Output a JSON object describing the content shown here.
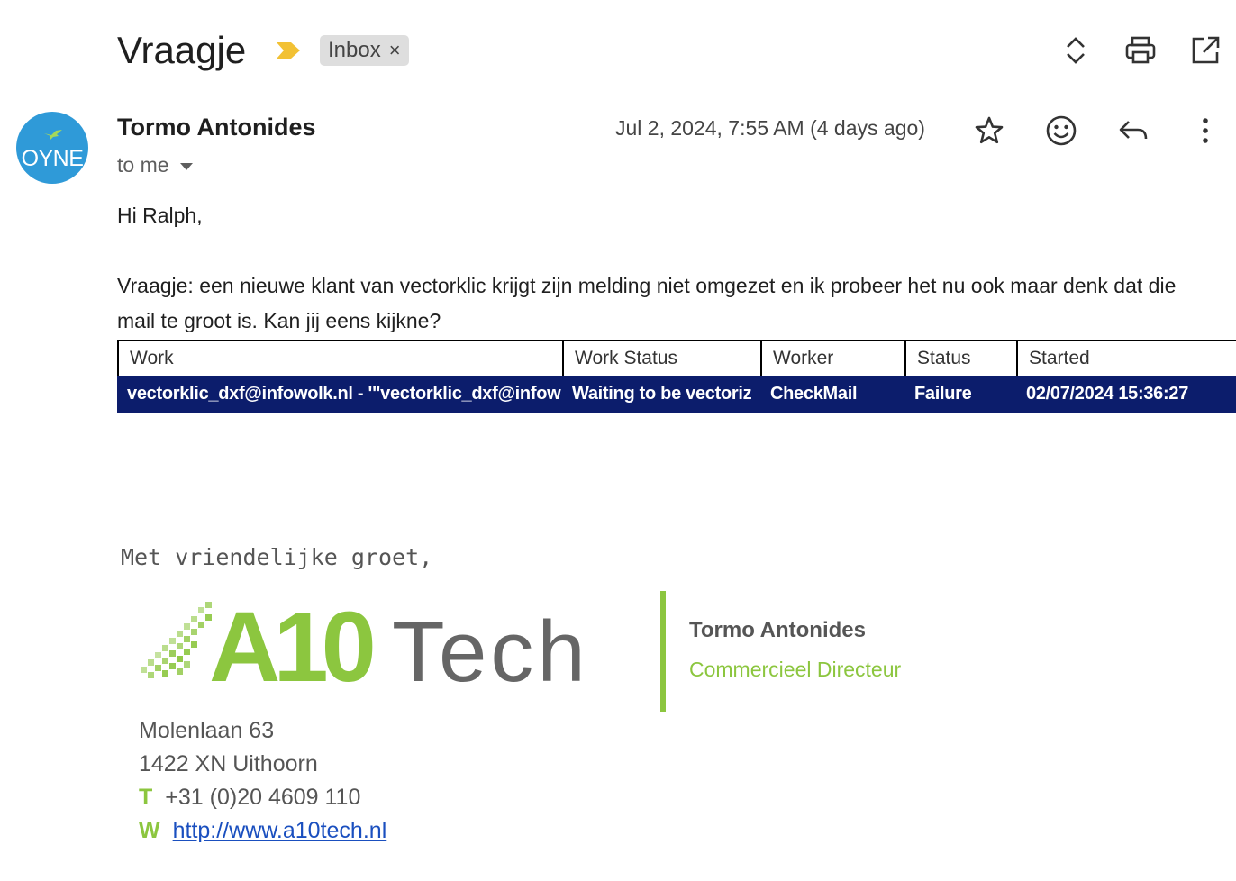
{
  "header": {
    "subject": "Vraagje",
    "label": "Inbox",
    "label_remove": "×",
    "toolbar_icons": [
      "expand-collapse-icon",
      "print-icon",
      "open-in-new-window-icon"
    ]
  },
  "message": {
    "avatar_text": "OYNE",
    "sender_name": "Tormo Antonides",
    "recipients": "to me",
    "date": "Jul 2, 2024, 7:55 AM (4 days ago)",
    "action_icons": [
      "star-icon",
      "emoji-icon",
      "reply-icon",
      "more-vert-icon"
    ],
    "greeting": "Hi Ralph,",
    "paragraph": "Vraagje: een nieuwe klant van vectorklic krijgt zijn melding niet omgezet en ik probeer het nu ook maar denk dat die mail te groot is. Kan jij eens kijkne?"
  },
  "embedded_table": {
    "headers": [
      "Work",
      "Work Status",
      "Worker",
      "Status",
      "Started"
    ],
    "rows": [
      [
        "vectorklic_dxf@infowolk.nl - '\"vectorklic_dxf@infow",
        "Waiting to be vectoriz",
        "CheckMail",
        "Failure",
        "02/07/2024 15:36:27"
      ]
    ]
  },
  "signature": {
    "closing": "Met vriendelijke groet,",
    "logo_text": {
      "a10": "A10",
      "tech": "Tech"
    },
    "name": "Tormo Antonides",
    "title": "Commercieel Directeur",
    "address_line1": "Molenlaan 63",
    "address_line2": "1422 XN Uithoorn",
    "phone_label": "T",
    "phone": "+31 (0)20 4609 110",
    "web_label": "W",
    "web": "http://www.a10tech.nl"
  },
  "colors": {
    "brand_green": "#8cc63f",
    "selection_blue": "#0c1d6c",
    "avatar_blue": "#2f9ad8",
    "important_marker": "#f2c134",
    "link_blue": "#1a4fbf"
  }
}
